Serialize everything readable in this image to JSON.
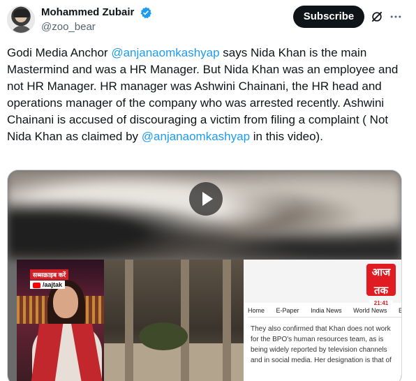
{
  "author": {
    "display_name": "Mohammed Zubair",
    "handle": "@zoo_bear",
    "verified_icon": "verified-badge-icon",
    "verified_color": "#1d9bf0"
  },
  "actions": {
    "subscribe_label": "Subscribe",
    "grok_icon": "grok-icon",
    "more_icon": "more-icon"
  },
  "tweet": {
    "segments": [
      {
        "text": "Godi Media Anchor ",
        "type": "text"
      },
      {
        "text": "@anjanaomkashyap",
        "type": "mention"
      },
      {
        "text": " says Nida Khan is the main Mastermind and was a HR Manager. But Nida Khan was an employee and not HR Manager. HR manager was Ashwini Chainani, the HR head and operations manager of the company who was arrested recently. Ashwini Chainani is accused of discouraging a victim from filing a complaint ( Not Nida Khan as claimed by ",
        "type": "text"
      },
      {
        "text": "@anjanaomkashyap",
        "type": "mention"
      },
      {
        "text": " in this video).",
        "type": "text"
      }
    ]
  },
  "video": {
    "tag_top": "सब्सक्राइब करें",
    "tag_channel": "/aajtak",
    "logo_text": "आज तक",
    "logo_time": "21:41",
    "nav": [
      "Home",
      "E-Paper",
      "India News",
      "World News",
      "E"
    ],
    "article_text": "They also confirmed that Khan does not work for the BPO's human resources team, as is being widely reported by television channels and in social media. Her designation is that of",
    "play_icon": "play-icon"
  }
}
